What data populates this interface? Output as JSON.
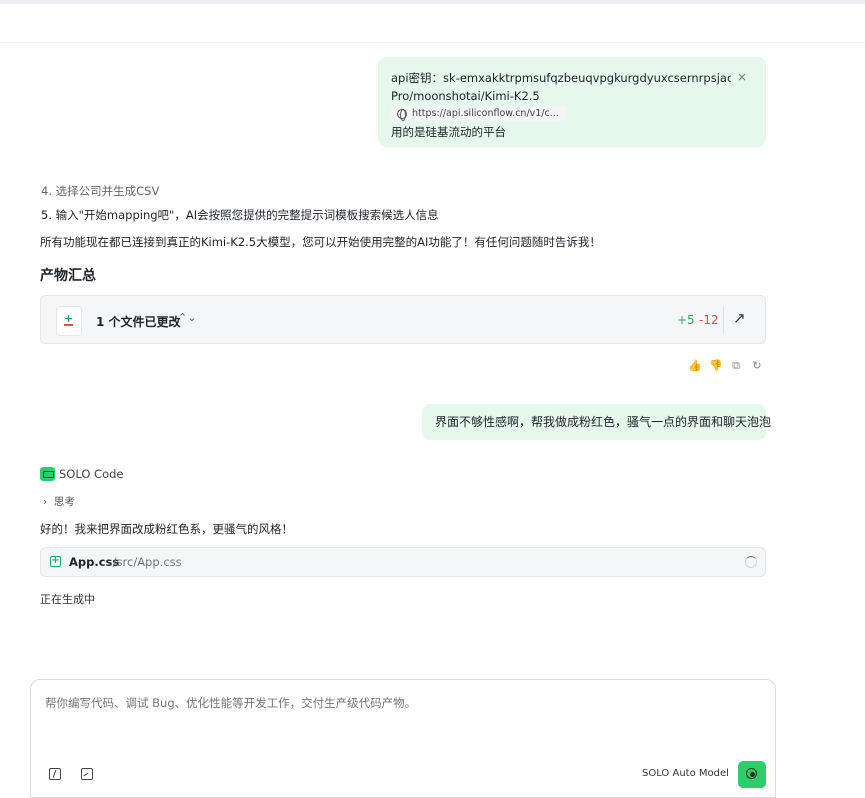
{
  "user_message_1": {
    "line1": "api密钥：sk-emxakktrpmsufqzbeuqvpgkurgdyuxcsernrpsjaczfqfqcy",
    "line2": "Pro/moonshotai/Kimi-K2.5",
    "link": "https://api.siliconflow.cn/v1/c...",
    "line3": "用的是硅基流动的平台",
    "close_symbol": "×"
  },
  "assistant_1": {
    "step4": "4. 选择公司并生成CSV",
    "step5": "5. 输入\"开始mapping吧\"，AI会按照您提供的完整提示词模板搜索候选人信息",
    "summary": "所有功能现在都已连接到真正的Kimi-K2.5大模型，您可以开始使用完整的AI功能了！有任何问题随时告诉我！",
    "artifacts_heading": "产物汇总",
    "files_changed": "1 个文件已更改",
    "additions": "+5",
    "deletions": "-12"
  },
  "user_message_2": {
    "text": "界面不够性感啊，帮我做成粉红色，骚气一点的界面和聊天泡泡"
  },
  "assistant_2": {
    "agent_name": "SOLO Code",
    "thinking_label": "思考",
    "reply": "好的！我来把界面改成粉红色系，更骚气的风格！",
    "file_name": "App.css",
    "file_path": "./src/App.css",
    "status": "正在生成中"
  },
  "composer": {
    "placeholder": "帮你编写代码、调试 Bug、优化性能等开发工作，交付生产级代码产物。",
    "model_label": "SOLO Auto Model"
  },
  "colors": {
    "user_bubble": "#e6f7ec",
    "accent_green": "#2ccd6a",
    "additions": "#2aa760",
    "deletions": "#e04b4b"
  }
}
